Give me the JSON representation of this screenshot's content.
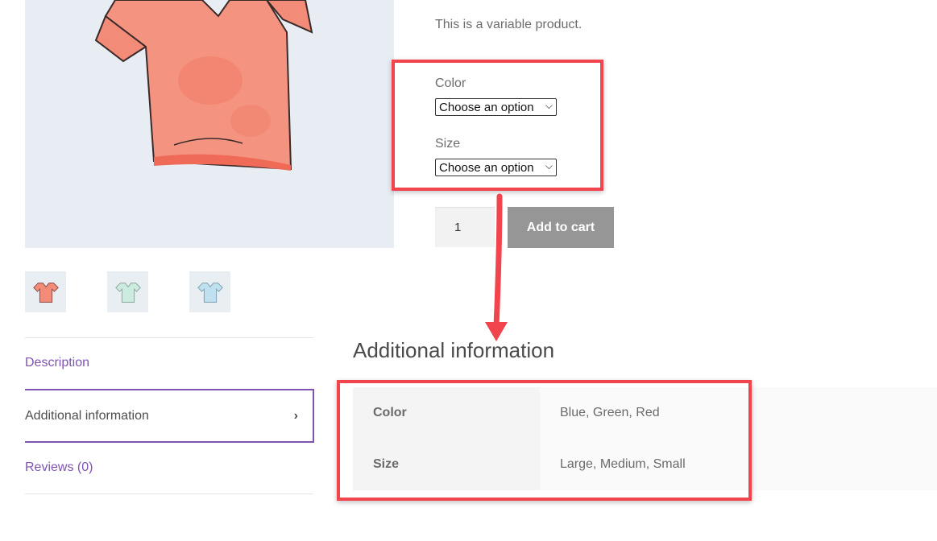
{
  "product": {
    "short_description": "This is a variable product.",
    "variations": [
      {
        "label": "Color",
        "selected": "Choose an option"
      },
      {
        "label": "Size",
        "selected": "Choose an option"
      }
    ],
    "quantity": "1",
    "add_to_cart_label": "Add to cart"
  },
  "tabs": [
    {
      "label": "Description"
    },
    {
      "label": "Additional information",
      "arrow": "›"
    },
    {
      "label": "Reviews (0)"
    }
  ],
  "additional_information": {
    "heading": "Additional information",
    "rows": [
      {
        "name": "Color",
        "value": "Blue, Green, Red"
      },
      {
        "name": "Size",
        "value": "Large, Medium, Small"
      }
    ]
  },
  "colors": {
    "accent": "#7f54b3",
    "annotation": "#f1444d",
    "button": "#969696"
  },
  "icons": {
    "dropdown": "chevron-down-icon",
    "tab_arrow": "chevron-right-icon"
  }
}
